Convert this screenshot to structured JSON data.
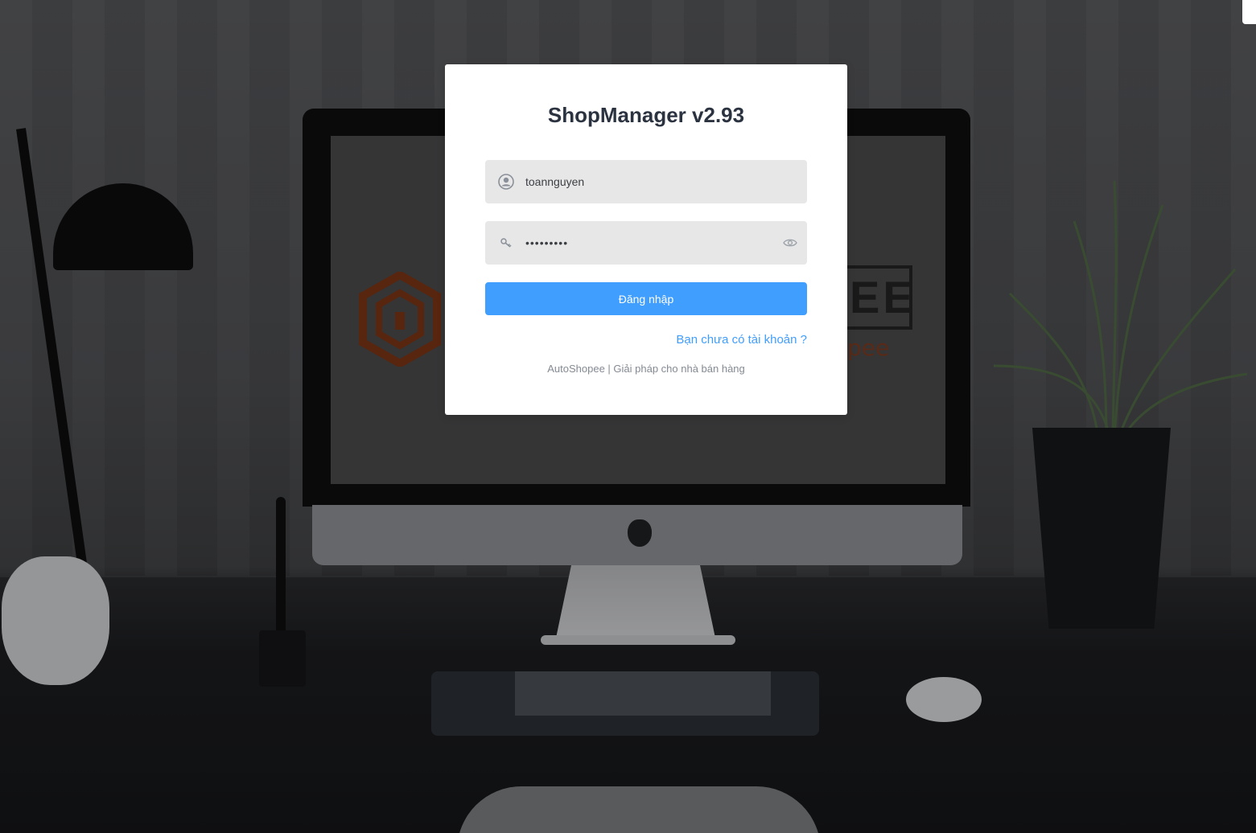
{
  "background": {
    "description_colors": {
      "wall": "#57585b",
      "desk": "#1c1d20",
      "overlay": "rgba(0,0,0,0.28)"
    },
    "screen_brand_text": "EE",
    "screen_brand_sub": "pee"
  },
  "login": {
    "title": "ShopManager v2.93",
    "username": {
      "value": "toannguyen",
      "icon": "user-icon"
    },
    "password": {
      "value": "123456789",
      "icon": "key-icon",
      "toggle_icon": "eye-icon"
    },
    "submit_label": "Đăng nhập",
    "signup_link": "Bạn chưa có tài khoản ?",
    "footer": "AutoShopee | Giải pháp cho nhà bán hàng"
  },
  "colors": {
    "accent": "#409eff",
    "title": "#2b3340",
    "field_bg": "#e7e7e7",
    "footer_text": "#848a93"
  }
}
